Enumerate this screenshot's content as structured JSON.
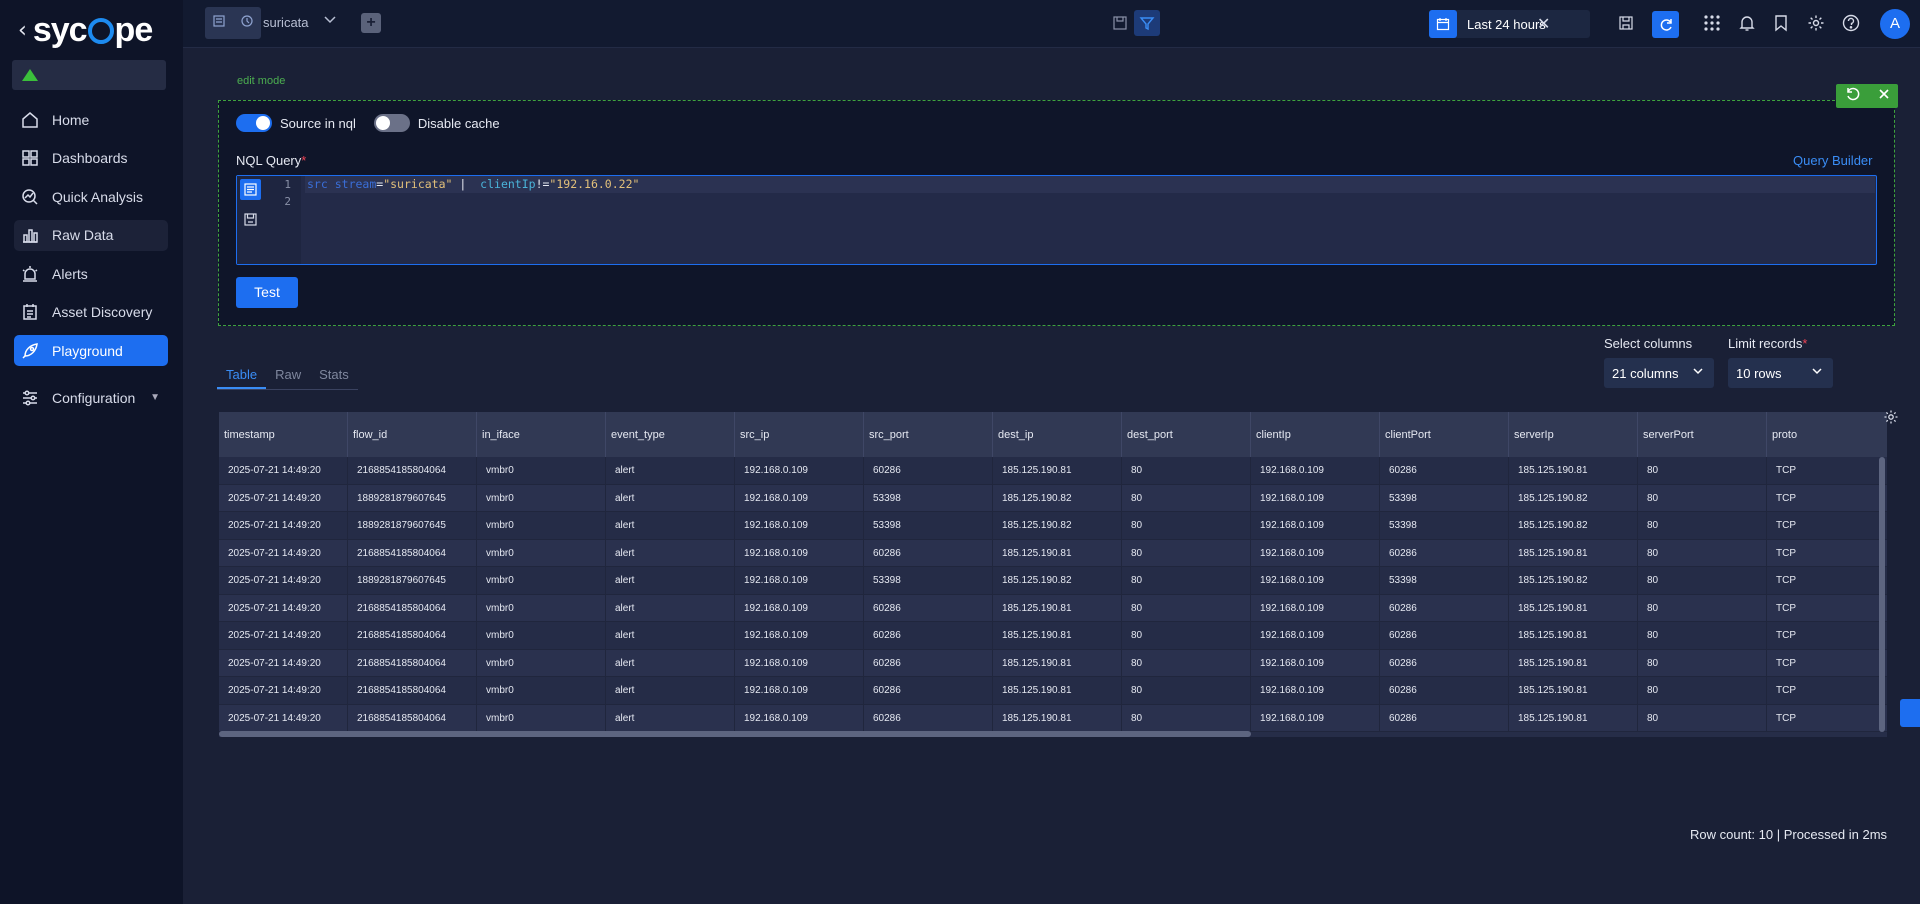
{
  "app": {
    "brand": "sycope"
  },
  "sidebar": {
    "items": [
      {
        "label": "Home",
        "icon": "home-icon"
      },
      {
        "label": "Dashboards",
        "icon": "dashboards-icon"
      },
      {
        "label": "Quick Analysis",
        "icon": "quick-analysis-icon"
      },
      {
        "label": "Raw Data",
        "icon": "raw-data-icon"
      },
      {
        "label": "Alerts",
        "icon": "alerts-icon"
      },
      {
        "label": "Asset Discovery",
        "icon": "asset-discovery-icon"
      },
      {
        "label": "Playground",
        "icon": "playground-icon"
      },
      {
        "label": "Configuration",
        "icon": "configuration-icon"
      }
    ]
  },
  "topbar": {
    "title": "suricata",
    "time_range": "Last 24 hours",
    "avatar_letter": "A"
  },
  "edit": {
    "mode_label": "edit mode",
    "source_toggle_label": "Source in nql",
    "cache_toggle_label": "Disable cache",
    "nql_label": "NQL Query",
    "required_mark": "*",
    "query_builder": "Query Builder",
    "line_numbers": [
      "1",
      "2"
    ],
    "query": {
      "p1": "src",
      "p2": "stream",
      "p3": "=",
      "p4": "\"suricata\"",
      "p5": " | ",
      "p6": "clientIp",
      "p7": "!=",
      "p8": "\"192.16.0.22\""
    },
    "test_button": "Test"
  },
  "tabs": [
    "Table",
    "Raw",
    "Stats"
  ],
  "controls": {
    "select_columns_label": "Select columns",
    "select_columns_value": "21 columns",
    "limit_label": "Limit records",
    "limit_value": "10 rows"
  },
  "table": {
    "headers": [
      "timestamp",
      "flow_id",
      "in_iface",
      "event_type",
      "src_ip",
      "src_port",
      "dest_ip",
      "dest_port",
      "clientIp",
      "clientPort",
      "serverIp",
      "serverPort",
      "proto"
    ],
    "rows": [
      [
        "2025-07-21 14:49:20",
        "2168854185804064",
        "vmbr0",
        "alert",
        "192.168.0.109",
        "60286",
        "185.125.190.81",
        "80",
        "192.168.0.109",
        "60286",
        "185.125.190.81",
        "80",
        "TCP"
      ],
      [
        "2025-07-21 14:49:20",
        "1889281879607645",
        "vmbr0",
        "alert",
        "192.168.0.109",
        "53398",
        "185.125.190.82",
        "80",
        "192.168.0.109",
        "53398",
        "185.125.190.82",
        "80",
        "TCP"
      ],
      [
        "2025-07-21 14:49:20",
        "1889281879607645",
        "vmbr0",
        "alert",
        "192.168.0.109",
        "53398",
        "185.125.190.82",
        "80",
        "192.168.0.109",
        "53398",
        "185.125.190.82",
        "80",
        "TCP"
      ],
      [
        "2025-07-21 14:49:20",
        "2168854185804064",
        "vmbr0",
        "alert",
        "192.168.0.109",
        "60286",
        "185.125.190.81",
        "80",
        "192.168.0.109",
        "60286",
        "185.125.190.81",
        "80",
        "TCP"
      ],
      [
        "2025-07-21 14:49:20",
        "1889281879607645",
        "vmbr0",
        "alert",
        "192.168.0.109",
        "53398",
        "185.125.190.82",
        "80",
        "192.168.0.109",
        "53398",
        "185.125.190.82",
        "80",
        "TCP"
      ],
      [
        "2025-07-21 14:49:20",
        "2168854185804064",
        "vmbr0",
        "alert",
        "192.168.0.109",
        "60286",
        "185.125.190.81",
        "80",
        "192.168.0.109",
        "60286",
        "185.125.190.81",
        "80",
        "TCP"
      ],
      [
        "2025-07-21 14:49:20",
        "2168854185804064",
        "vmbr0",
        "alert",
        "192.168.0.109",
        "60286",
        "185.125.190.81",
        "80",
        "192.168.0.109",
        "60286",
        "185.125.190.81",
        "80",
        "TCP"
      ],
      [
        "2025-07-21 14:49:20",
        "2168854185804064",
        "vmbr0",
        "alert",
        "192.168.0.109",
        "60286",
        "185.125.190.81",
        "80",
        "192.168.0.109",
        "60286",
        "185.125.190.81",
        "80",
        "TCP"
      ],
      [
        "2025-07-21 14:49:20",
        "2168854185804064",
        "vmbr0",
        "alert",
        "192.168.0.109",
        "60286",
        "185.125.190.81",
        "80",
        "192.168.0.109",
        "60286",
        "185.125.190.81",
        "80",
        "TCP"
      ],
      [
        "2025-07-21 14:49:20",
        "2168854185804064",
        "vmbr0",
        "alert",
        "192.168.0.109",
        "60286",
        "185.125.190.81",
        "80",
        "192.168.0.109",
        "60286",
        "185.125.190.81",
        "80",
        "TCP"
      ]
    ]
  },
  "footer": {
    "status": "Row count: 10  |  Processed in 2ms"
  },
  "colors": {
    "accent": "#1d6ef0",
    "edit_border": "#3ea33e",
    "brand_ring": "#1d8bf0"
  }
}
